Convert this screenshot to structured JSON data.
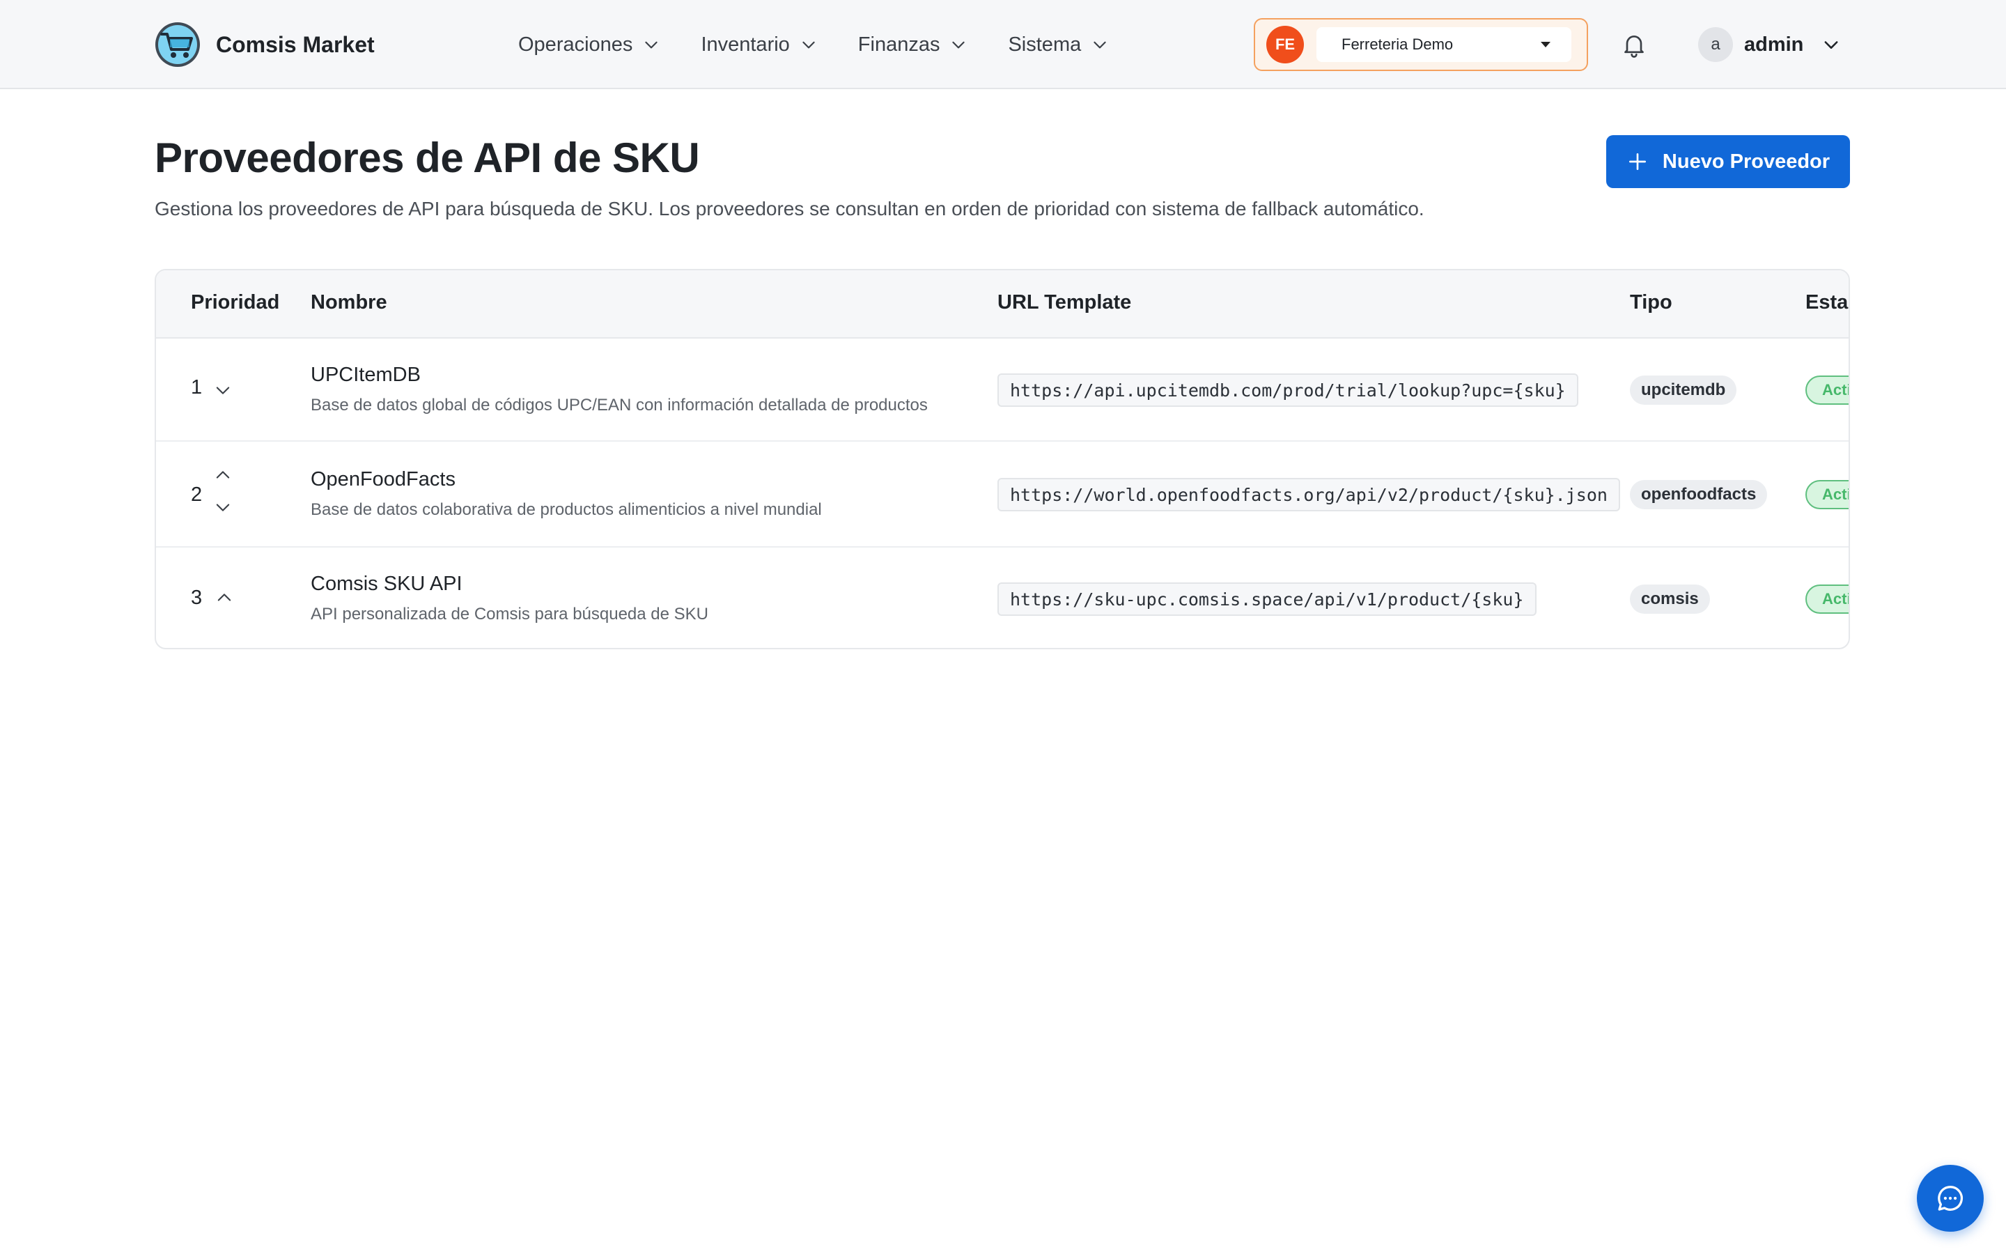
{
  "brand": {
    "name": "Comsis Market"
  },
  "nav": {
    "items": [
      {
        "label": "Operaciones"
      },
      {
        "label": "Inventario"
      },
      {
        "label": "Finanzas"
      },
      {
        "label": "Sistema"
      }
    ]
  },
  "store": {
    "initials": "FE",
    "name": "Ferreteria Demo"
  },
  "user": {
    "initial": "a",
    "name": "admin"
  },
  "page": {
    "title": "Proveedores de API de SKU",
    "subtitle": "Gestiona los proveedores de API para búsqueda de SKU. Los proveedores se consultan en orden de prioridad con sistema de fallback automático.",
    "new_button": "Nuevo Proveedor"
  },
  "table": {
    "headers": {
      "prioridad": "Prioridad",
      "nombre": "Nombre",
      "url": "URL Template",
      "tipo": "Tipo",
      "estado": "Estado"
    },
    "rows": [
      {
        "priority": "1",
        "name": "UPCItemDB",
        "description": "Base de datos global de códigos UPC/EAN con información detallada de productos",
        "url": "https://api.upcitemdb.com/prod/trial/lookup?upc={sku}",
        "type": "upcitemdb",
        "status": "Activo"
      },
      {
        "priority": "2",
        "name": "OpenFoodFacts",
        "description": "Base de datos colaborativa de productos alimenticios a nivel mundial",
        "url": "https://world.openfoodfacts.org/api/v2/product/{sku}.json",
        "type": "openfoodfacts",
        "status": "Activo"
      },
      {
        "priority": "3",
        "name": "Comsis SKU API",
        "description": "API personalizada de Comsis para búsqueda de SKU",
        "url": "https://sku-upc.comsis.space/api/v1/product/{sku}",
        "type": "comsis",
        "status": "Activo"
      }
    ]
  },
  "colors": {
    "primary": "#1168d8",
    "store_accent": "#f04e1b",
    "status_green": "#46b86a"
  },
  "icons": {
    "logo": "shopping-cart-logo-icon",
    "nav_chevron": "chevron-down-icon",
    "store_caret": "caret-down-icon",
    "notifications": "bell-icon",
    "user_menu": "chevron-down-icon",
    "new": "plus-icon",
    "move_up": "chevron-up-icon",
    "move_down": "chevron-down-icon",
    "chat": "chat-bubble-icon"
  }
}
